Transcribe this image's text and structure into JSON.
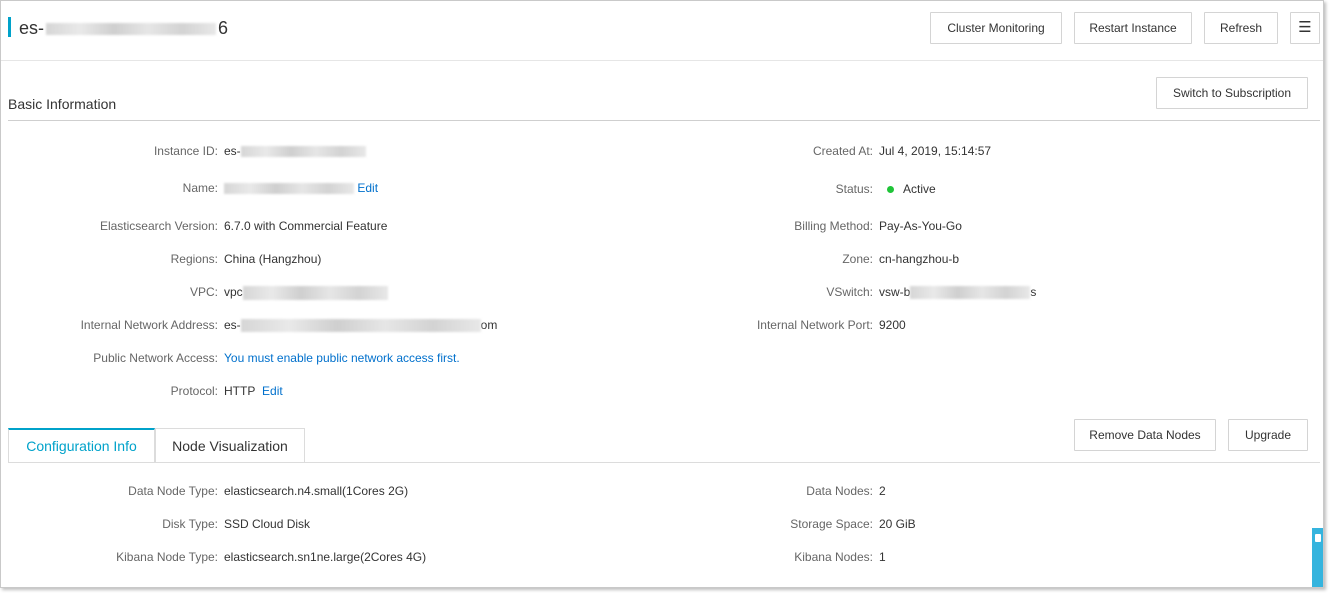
{
  "header": {
    "title_prefix": "es-",
    "title_suffix": "6",
    "buttons": {
      "cluster_monitoring": "Cluster Monitoring",
      "restart_instance": "Restart Instance",
      "refresh": "Refresh",
      "menu_icon": "☰"
    }
  },
  "basic_info": {
    "title": "Basic Information",
    "switch_button": "Switch to Subscription",
    "left": {
      "instance_id": {
        "label": "Instance ID:",
        "value": "es-"
      },
      "name": {
        "label": "Name:",
        "edit": "Edit"
      },
      "es_version": {
        "label": "Elasticsearch Version:",
        "value": "6.7.0 with Commercial Feature"
      },
      "regions": {
        "label": "Regions:",
        "value": "China (Hangzhou)"
      },
      "vpc": {
        "label": "VPC:",
        "value": "vpc"
      },
      "internal_address": {
        "label": "Internal Network Address:",
        "value_prefix": "es-",
        "value_suffix": "om"
      },
      "public_access": {
        "label": "Public Network Access:",
        "value": "You must enable public network access first."
      },
      "protocol": {
        "label": "Protocol:",
        "value": "HTTP",
        "edit": "Edit"
      }
    },
    "right": {
      "created_at": {
        "label": "Created At:",
        "value": "Jul 4, 2019, 15:14:57"
      },
      "status": {
        "label": "Status:",
        "value": "Active",
        "color": "#1fc438"
      },
      "billing": {
        "label": "Billing Method:",
        "value": "Pay-As-You-Go"
      },
      "zone": {
        "label": "Zone:",
        "value": "cn-hangzhou-b"
      },
      "vswitch": {
        "label": "VSwitch:",
        "value_prefix": "vsw-b",
        "value_suffix": "s"
      },
      "internal_port": {
        "label": "Internal Network Port:",
        "value": "9200"
      }
    }
  },
  "tabs": {
    "items": [
      "Configuration Info",
      "Node Visualization"
    ],
    "active": "Configuration Info",
    "remove_data_nodes": "Remove Data Nodes",
    "upgrade": "Upgrade"
  },
  "config": {
    "left": {
      "data_node_type": {
        "label": "Data Node Type:",
        "value": "elasticsearch.n4.small(1Cores 2G)"
      },
      "disk_type": {
        "label": "Disk Type:",
        "value": "SSD Cloud Disk"
      },
      "kibana_node_type": {
        "label": "Kibana Node Type:",
        "value": "elasticsearch.sn1ne.large(2Cores 4G)"
      }
    },
    "right": {
      "data_nodes": {
        "label": "Data Nodes:",
        "value": "2"
      },
      "storage_space": {
        "label": "Storage Space:",
        "value": "20 GiB"
      },
      "kibana_nodes": {
        "label": "Kibana Nodes:",
        "value": "1"
      }
    }
  },
  "colors": {
    "accent": "#00a2ca",
    "link": "#0070cc"
  }
}
